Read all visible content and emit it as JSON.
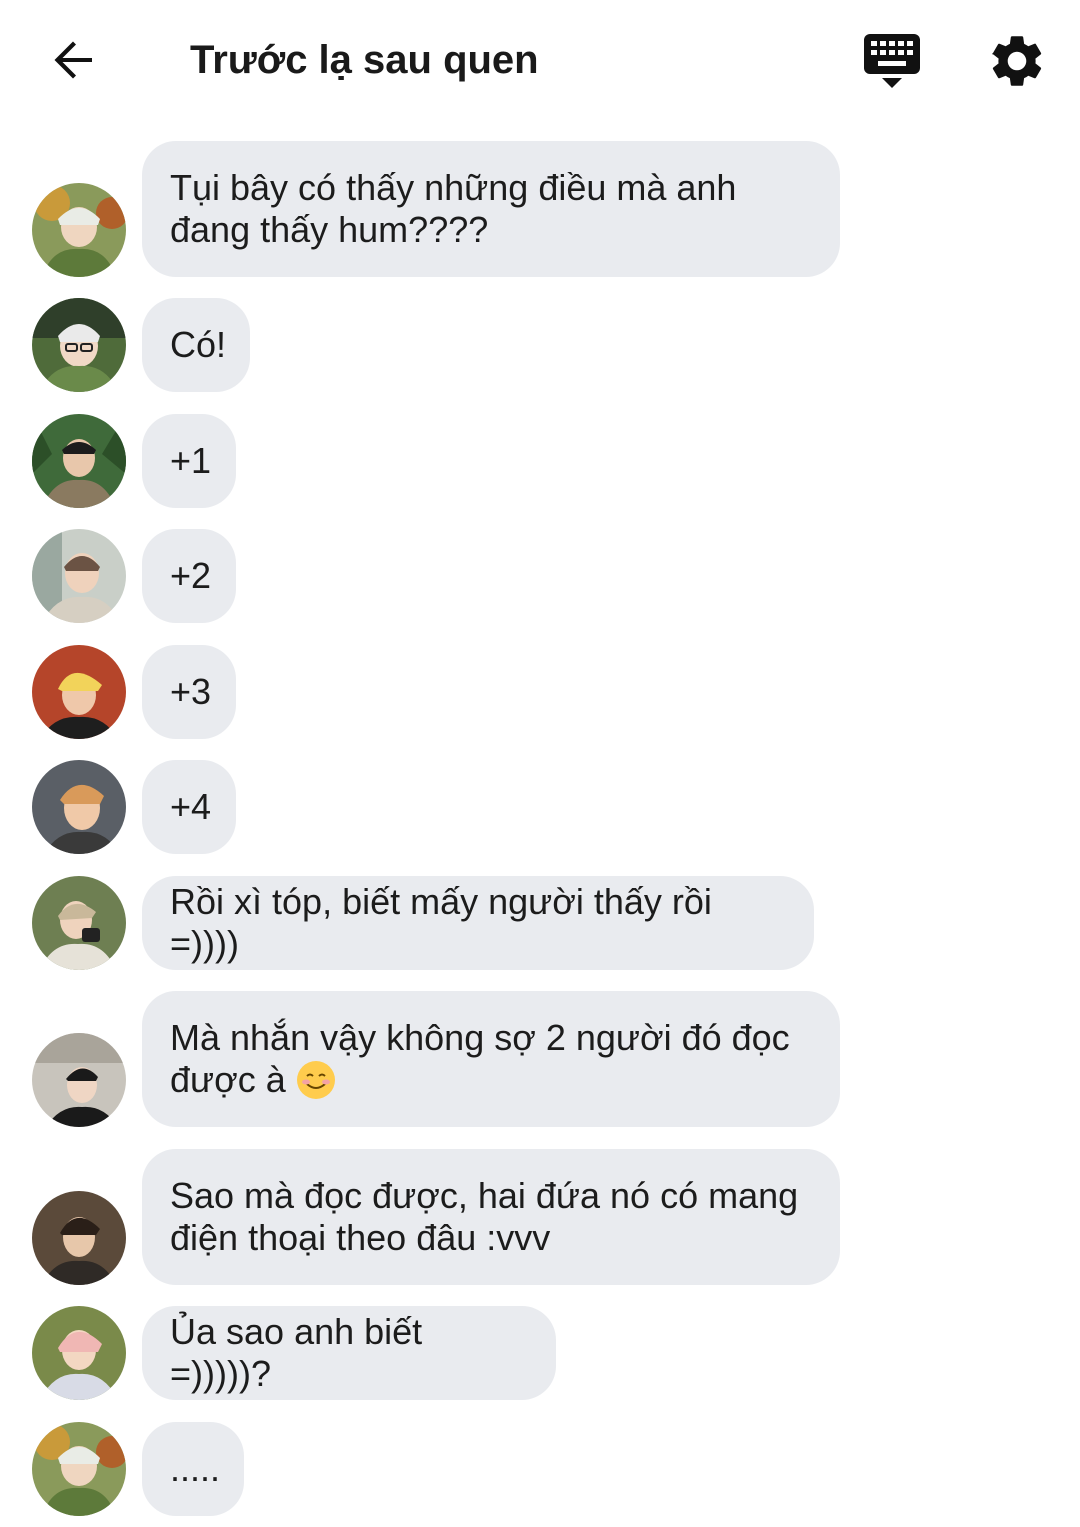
{
  "header": {
    "title": "Trước lạ sau quen",
    "back_icon": "arrow-back-icon",
    "keyboard_icon": "keyboard-hide-icon",
    "settings_icon": "gear-icon"
  },
  "colors": {
    "bubble_bg": "#e9ebef",
    "text": "#1c1c1c",
    "icon": "#111111"
  },
  "messages": [
    {
      "text": "Tụi bây có thấy những điều mà anh đang thấy hum????"
    },
    {
      "text": "Có!"
    },
    {
      "text": "+1"
    },
    {
      "text": "+2"
    },
    {
      "text": "+3"
    },
    {
      "text": "+4"
    },
    {
      "text": "Rồi xì tóp, biết mấy người thấy rồi =))))"
    },
    {
      "text": "Mà nhắn vậy không sợ 2 người đó đọc được à",
      "emoji": "smiling-face-emoji"
    },
    {
      "text": "Sao mà đọc được, hai đứa nó có mang điện thoại theo đâu :vvv"
    },
    {
      "text": "Ủa sao anh biết =)))))?"
    },
    {
      "text": "....."
    }
  ]
}
